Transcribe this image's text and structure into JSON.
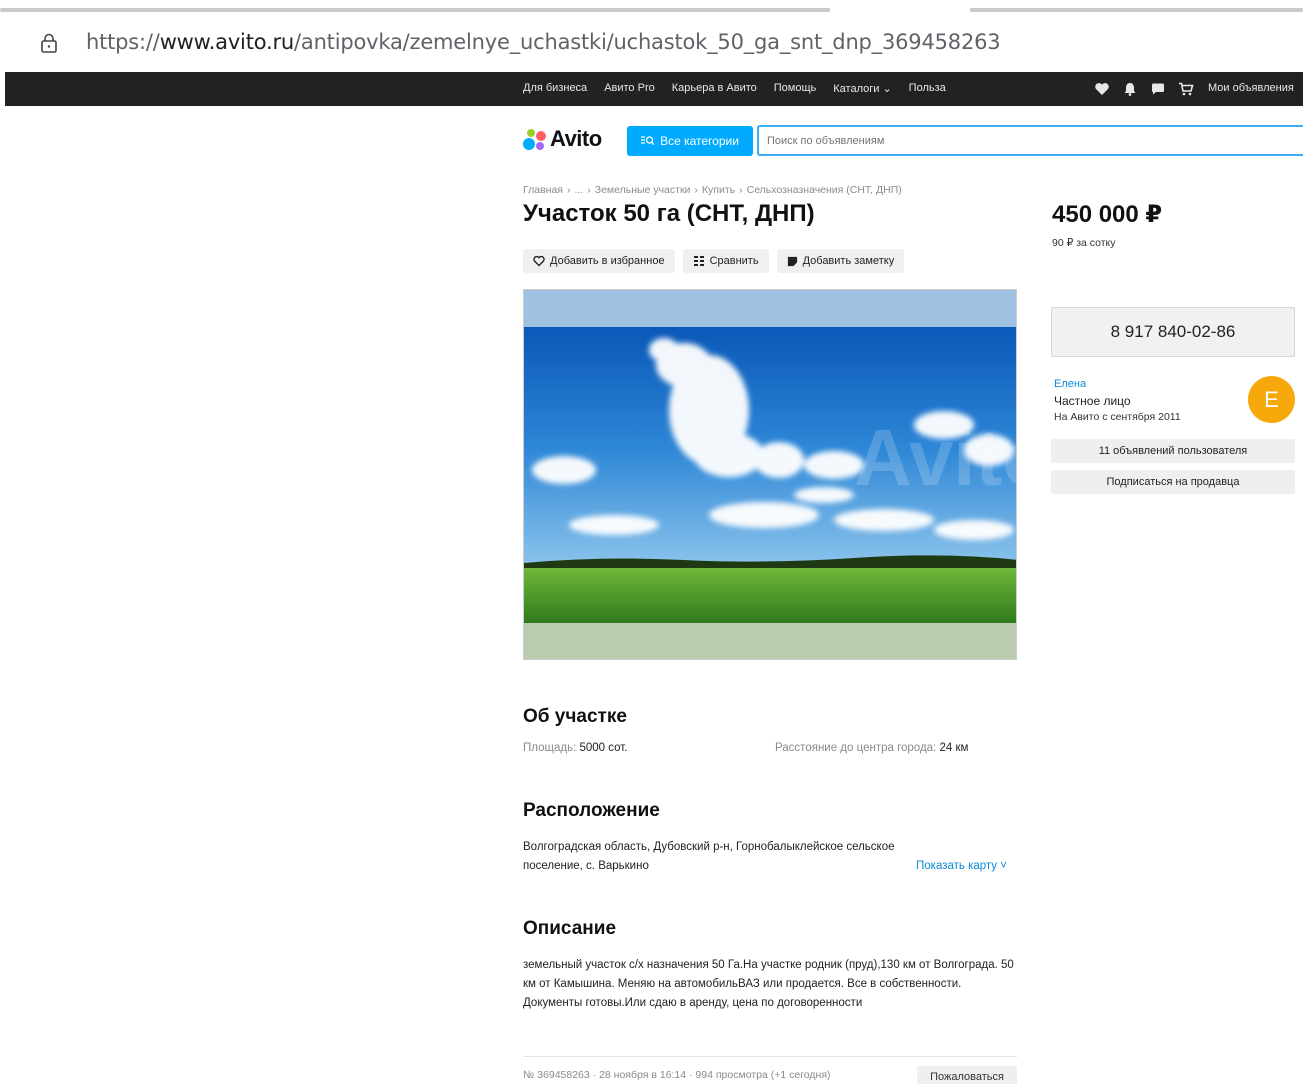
{
  "browser": {
    "url_scheme": "https://",
    "url_host": "www.avito.ru",
    "url_path": "/antipovka/zemelnye_uchastki/uchastok_50_ga_snt_dnp_369458263"
  },
  "topnav": {
    "links": [
      "Для бизнеса",
      "Авито Pro",
      "Карьера в Авито",
      "Помощь",
      "Каталоги ⌄",
      "Польза"
    ],
    "my_ads": "Мои объявления",
    "icons": [
      "heart-icon",
      "bell-icon",
      "chat-icon",
      "cart-icon"
    ]
  },
  "header": {
    "logo_text": "Avito",
    "categories_label": "Все категории",
    "search_placeholder": "Поиск по объявлениям"
  },
  "breadcrumb": [
    "Главная",
    "›",
    "...",
    "›",
    "Земельные участки",
    "›",
    "Купить",
    "›",
    "Сельхозназначения (СНТ, ДНП)"
  ],
  "listing": {
    "title": "Участок 50 га (СНТ, ДНП)",
    "actions": {
      "favorite": "Добавить в избранное",
      "compare": "Сравнить",
      "note": "Добавить заметку"
    },
    "price": "450 000 ₽",
    "price_per_unit": "90 ₽ за сотку"
  },
  "seller": {
    "phone": "8 917 840-02-86",
    "name": "Елена",
    "type": "Частное лицо",
    "since": "На Авито с сентября 2011",
    "avatar_letter": "E",
    "ads_button": "11 объявлений пользователя",
    "subscribe_button": "Подписаться на продавца"
  },
  "about": {
    "heading": "Об участке",
    "area_label": "Площадь:",
    "area_value": "5000 сот.",
    "distance_label": "Расстояние до центра города:",
    "distance_value": "24 км"
  },
  "location": {
    "heading": "Расположение",
    "address": "Волгоградская область, Дубовский р-н, Горнобалыклейское сельское поселение, с. Варькино",
    "map_link": "Показать карту ˅"
  },
  "description": {
    "heading": "Описание",
    "text": "земельный участок с/х назначения 50 Га.На участке родник (пруд),130 км от Волгограда. 50 км от Камышина. Меняю на автомобильВАЗ или продается. Все в собственности. Документы готовы.Или сдаю в аренду, цена по договоренности"
  },
  "footer": {
    "meta": "№ 369458263 · 28 ноября в 16:14 · 994 просмотра (+1 сегодня)",
    "complain": "Пожаловаться"
  },
  "colors": {
    "accent_blue": "#00aaff",
    "link_blue": "#0a8ad6",
    "avatar_orange": "#f7a80b",
    "topbar": "#222222"
  }
}
